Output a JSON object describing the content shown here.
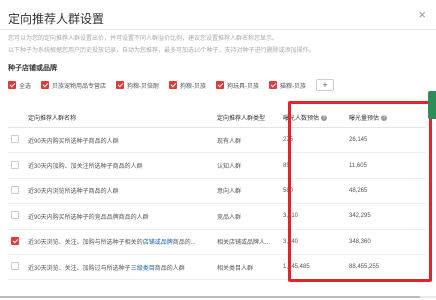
{
  "dialog": {
    "title": "定向推荐人群设置",
    "close_symbol": "×",
    "notice_line1": "您可以为您的定向推荐人群设置出价，并可设置不同人群溢价比例，建议您设置推荐人群名称您显示。",
    "notice_line2": "以下种子为系统根据您用户历史投放记录，自动为您推荐，最多可加选10个种子，支持对种子进行删除或添加操作。"
  },
  "seed_section": {
    "title": "种子店铺或品牌",
    "categories": [
      {
        "label": "全选",
        "checked": true
      },
      {
        "label": "贝族宠物用品专营店",
        "checked": true
      },
      {
        "label": "狗粮-贝倍耐",
        "checked": true
      },
      {
        "label": "狗粮-贝族",
        "checked": true
      },
      {
        "label": "狗玩具-贝族",
        "checked": true
      },
      {
        "label": "猫粮-贝族",
        "checked": true
      }
    ],
    "add_button": "+"
  },
  "table": {
    "headers": [
      "定向推荐人群名称",
      "定向推荐人群类型",
      "曝光人数预估",
      "曝光量预估"
    ],
    "help_icon": "?",
    "rows": [
      {
        "checked": false,
        "name": "近90天内购买所选种子商品的人群",
        "name_hl": "",
        "name_suffix": "",
        "type": "现有人群",
        "people": "275",
        "impressions": "26,145"
      },
      {
        "checked": false,
        "name": "近30天内加购、加关注所选种子商品的人群",
        "name_hl": "",
        "name_suffix": "",
        "type": "认知人群",
        "people": "85",
        "impressions": "11,605"
      },
      {
        "checked": false,
        "name": "近30天内浏览所选种子商品的人群",
        "name_hl": "",
        "name_suffix": "",
        "type": "意向人群",
        "people": "580",
        "impressions": "48,265"
      },
      {
        "checked": false,
        "name": "近90天内购买所选种子的竞品品牌商品的人群",
        "name_hl": "",
        "name_suffix": "",
        "type": "竞品人群",
        "people": "3,810",
        "impressions": "342,295"
      },
      {
        "checked": true,
        "name": "近30天浏览、关注、加购与所选种子相关的",
        "name_hl": "店铺或品牌",
        "name_suffix": "商品的...",
        "type": "相关店铺或品牌人...",
        "people": "3,140",
        "impressions": "348,360"
      },
      {
        "checked": false,
        "name": "近30天浏览、关注、加购过与所选种子",
        "name_hl": "三级类目",
        "name_suffix": "商品的人群",
        "type": "相关类目人群",
        "people": "1,045,485",
        "impressions": "88,455,255"
      }
    ]
  },
  "colors": {
    "highlight_box": "#e0232d",
    "checkbox_on": "#e4393c",
    "side_tab": "#2d8c5a"
  }
}
